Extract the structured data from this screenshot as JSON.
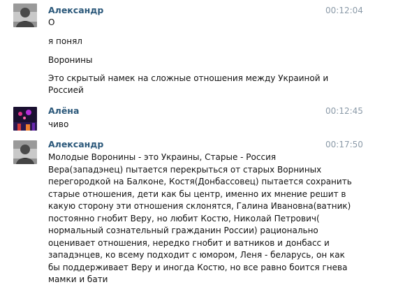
{
  "messages": [
    {
      "author": "Александр",
      "time": "00:12:04",
      "avatar_icon": "user-photo-icon",
      "lines": [
        "О",
        "я понял",
        "Воронины",
        "Это скрытый намек на сложные отношения между Украиной и",
        "Россией"
      ]
    },
    {
      "author": "Алёна",
      "time": "00:12:45",
      "avatar_icon": "user-photo-icon",
      "lines": [
        "чиво"
      ]
    },
    {
      "author": "Александр",
      "time": "00:17:50",
      "avatar_icon": "user-photo-icon",
      "lines": [
        "Молодые Воронины - это Украины, Старые - Россия",
        "Вера(западэнец) пытается перекрыться от старых Ворниных",
        "перегородкой на Балконе, Костя(Донбассовец) пытается сохранить",
        "старые отношения, дети как бы центр, именно их мнение решит в",
        "какую сторону эти отношения склонятся, Галина Ивановна(ватник)",
        "постоянно гнобит Веру, но любит Костю, Николай Петрович(",
        "нормальный сознательный гражданин России) рационально",
        "оценивает отношения, нередко гнобит и ватников и донбасс и",
        "западэнцев, ко всему подходит с юмором, Леня - беларусь, он как",
        "бы поддерживает Веру и иногда Костю, но все равно боится гнева",
        "мамки и бати"
      ]
    }
  ],
  "colors": {
    "author": "#2b587a",
    "time": "#8b9aa8",
    "text": "#111111",
    "background": "#ffffff"
  }
}
